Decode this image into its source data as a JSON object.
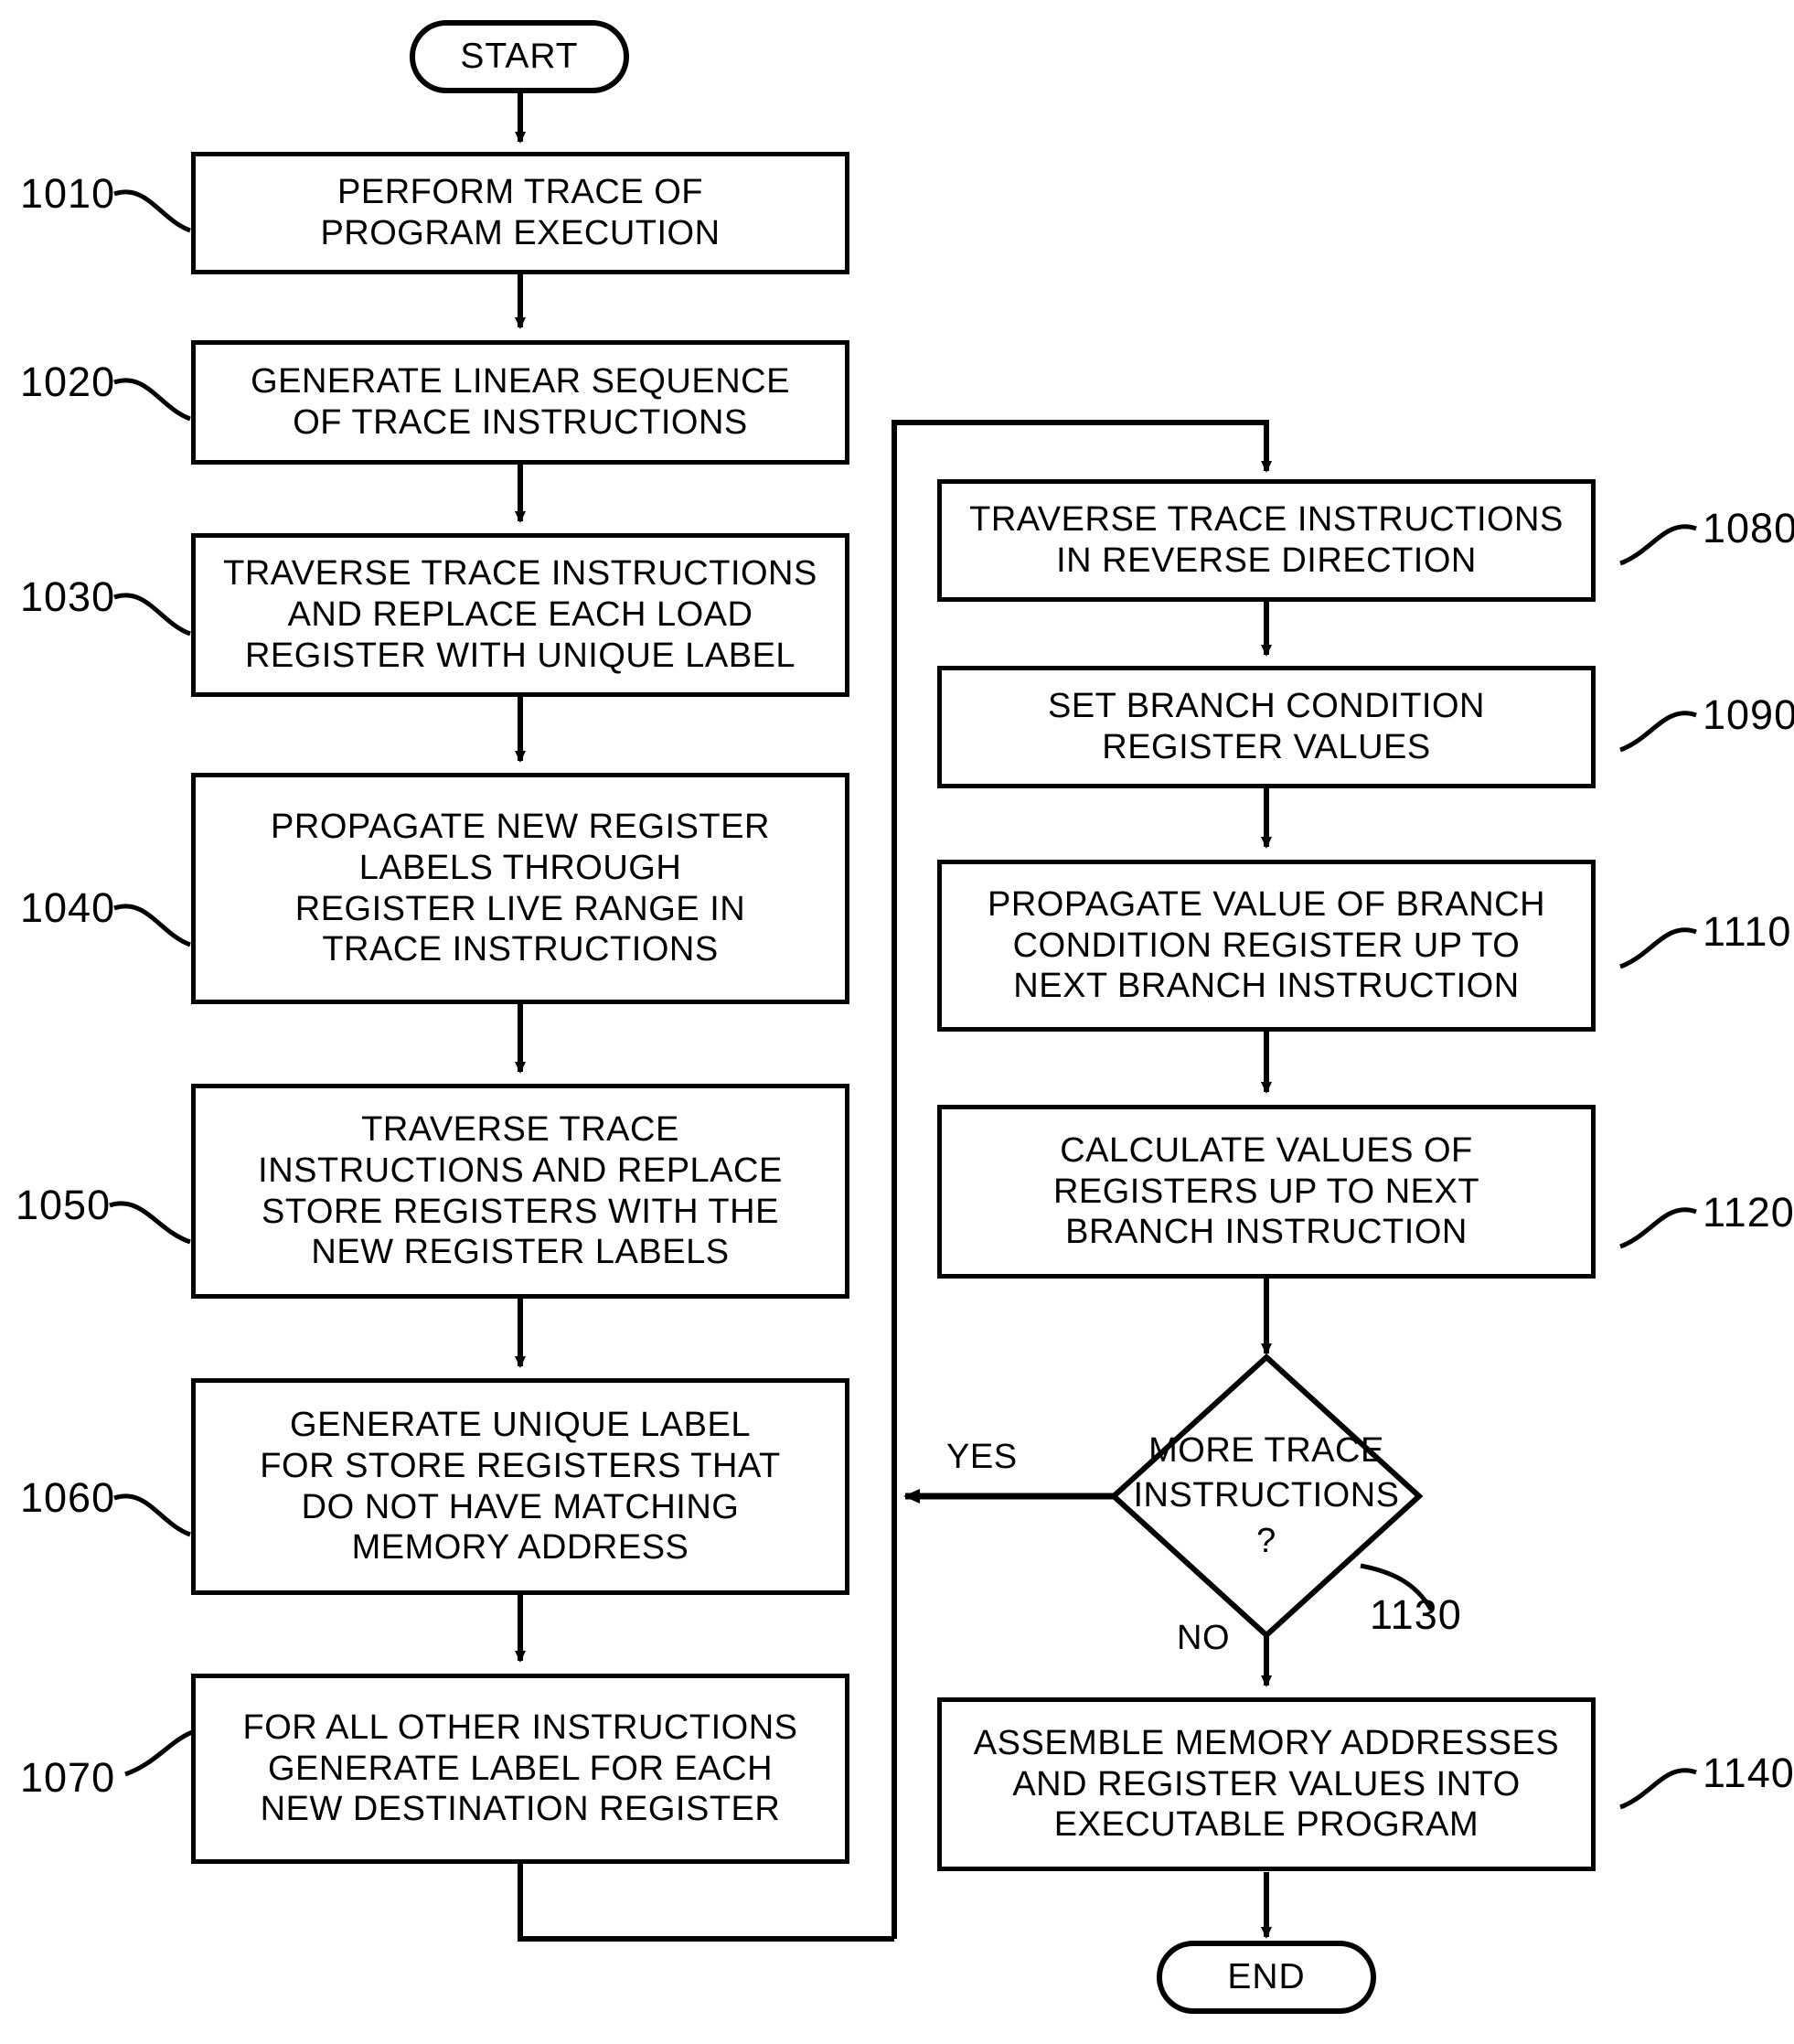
{
  "figure": {
    "type": "flowchart",
    "orientation": "two-column",
    "terminals": {
      "start": "START",
      "end": "END"
    },
    "edge_labels": {
      "yes": "YES",
      "no": "NO"
    },
    "nodes": [
      {
        "ref": "1010",
        "shape": "process",
        "lines": [
          "PERFORM TRACE OF",
          "PROGRAM EXECUTION"
        ]
      },
      {
        "ref": "1020",
        "shape": "process",
        "lines": [
          "GENERATE LINEAR SEQUENCE",
          "OF TRACE INSTRUCTIONS"
        ]
      },
      {
        "ref": "1030",
        "shape": "process",
        "lines": [
          "TRAVERSE TRACE INSTRUCTIONS",
          "AND REPLACE EACH LOAD",
          "REGISTER WITH UNIQUE LABEL"
        ]
      },
      {
        "ref": "1040",
        "shape": "process",
        "lines": [
          "PROPAGATE NEW REGISTER",
          "LABELS THROUGH",
          "REGISTER LIVE RANGE IN",
          "TRACE INSTRUCTIONS"
        ]
      },
      {
        "ref": "1050",
        "shape": "process",
        "lines": [
          "TRAVERSE TRACE",
          "INSTRUCTIONS AND REPLACE",
          "STORE REGISTERS WITH THE",
          "NEW REGISTER LABELS"
        ]
      },
      {
        "ref": "1060",
        "shape": "process",
        "lines": [
          "GENERATE UNIQUE LABEL",
          "FOR STORE REGISTERS THAT",
          "DO NOT HAVE MATCHING",
          "MEMORY ADDRESS"
        ]
      },
      {
        "ref": "1070",
        "shape": "process",
        "lines": [
          "FOR ALL OTHER INSTRUCTIONS",
          "GENERATE LABEL FOR EACH",
          "NEW DESTINATION REGISTER"
        ]
      },
      {
        "ref": "1080",
        "shape": "process",
        "lines": [
          "TRAVERSE TRACE INSTRUCTIONS",
          "IN REVERSE DIRECTION"
        ]
      },
      {
        "ref": "1090",
        "shape": "process",
        "lines": [
          "SET BRANCH CONDITION",
          "REGISTER VALUES"
        ]
      },
      {
        "ref": "1110",
        "shape": "process",
        "lines": [
          "PROPAGATE VALUE OF BRANCH",
          "CONDITION REGISTER UP TO",
          "NEXT BRANCH INSTRUCTION"
        ]
      },
      {
        "ref": "1120",
        "shape": "process",
        "lines": [
          "CALCULATE VALUES OF",
          "REGISTERS UP TO NEXT",
          "BRANCH INSTRUCTION"
        ]
      },
      {
        "ref": "1130",
        "shape": "decision",
        "lines": [
          "MORE TRACE",
          "INSTRUCTIONS",
          "?"
        ]
      },
      {
        "ref": "1140",
        "shape": "process",
        "lines": [
          "ASSEMBLE MEMORY ADDRESSES",
          "AND REGISTER VALUES INTO",
          "EXECUTABLE PROGRAM"
        ]
      }
    ],
    "colors": {
      "stroke": "#000000",
      "fill": "#ffffff",
      "text": "#000000"
    }
  }
}
